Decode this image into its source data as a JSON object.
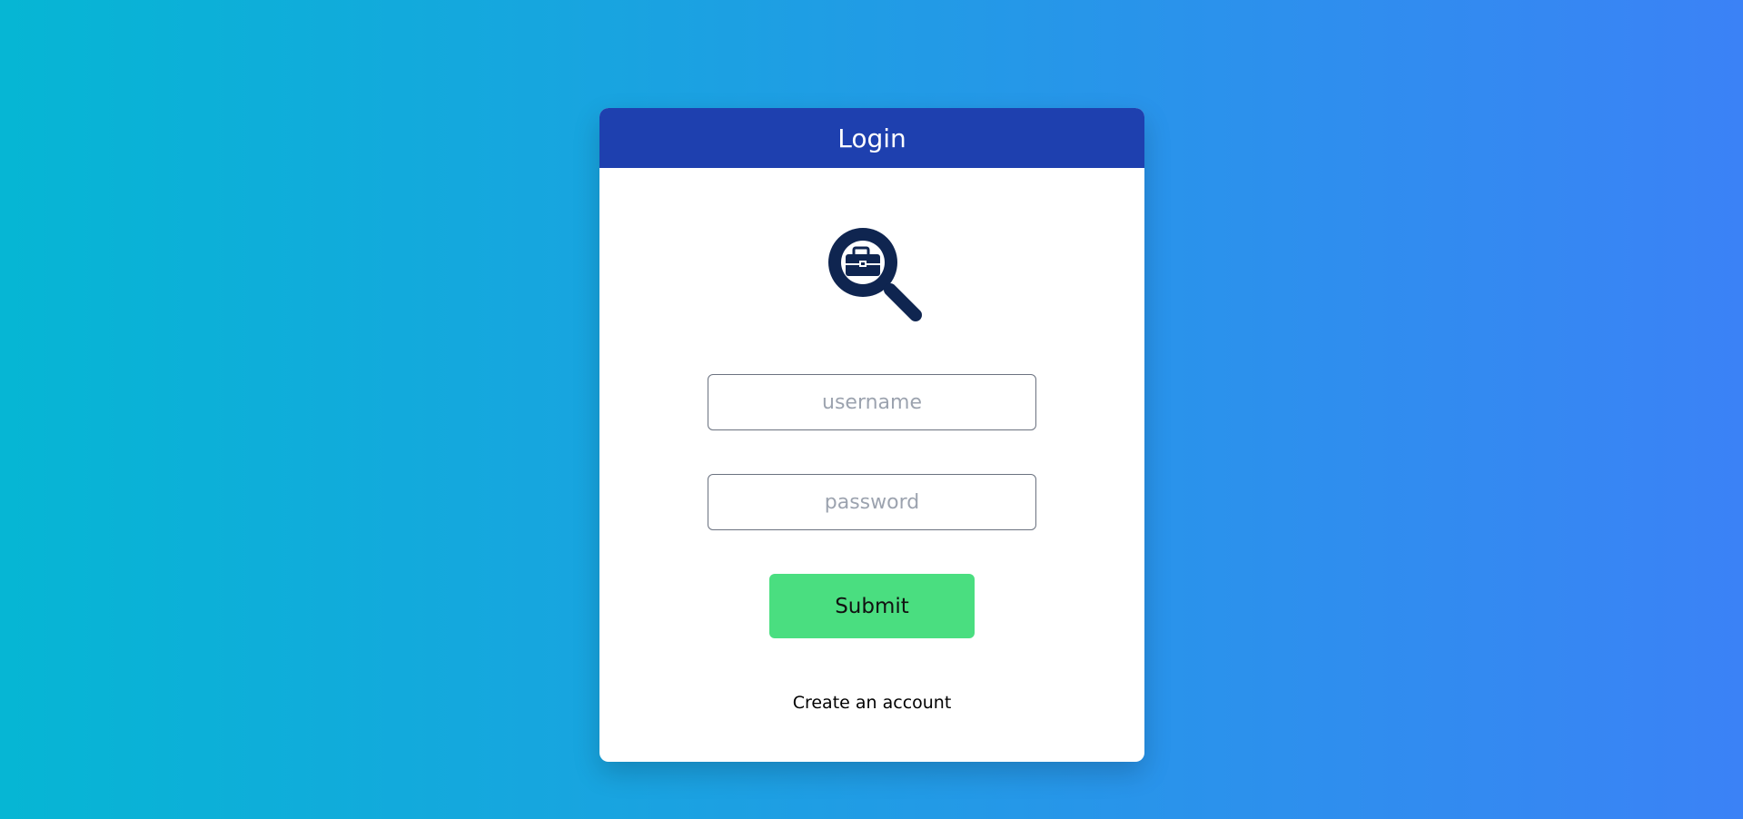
{
  "header": {
    "title": "Login"
  },
  "logo": {
    "icon": "job-search-icon",
    "color": "#0f2550"
  },
  "form": {
    "username_placeholder": "username",
    "password_placeholder": "password",
    "submit_label": "Submit",
    "create_account_label": "Create an account"
  },
  "colors": {
    "background_start": "#06b6d4",
    "background_end": "#3b82f6",
    "header": "#1e40af",
    "submit": "#4ade80"
  }
}
